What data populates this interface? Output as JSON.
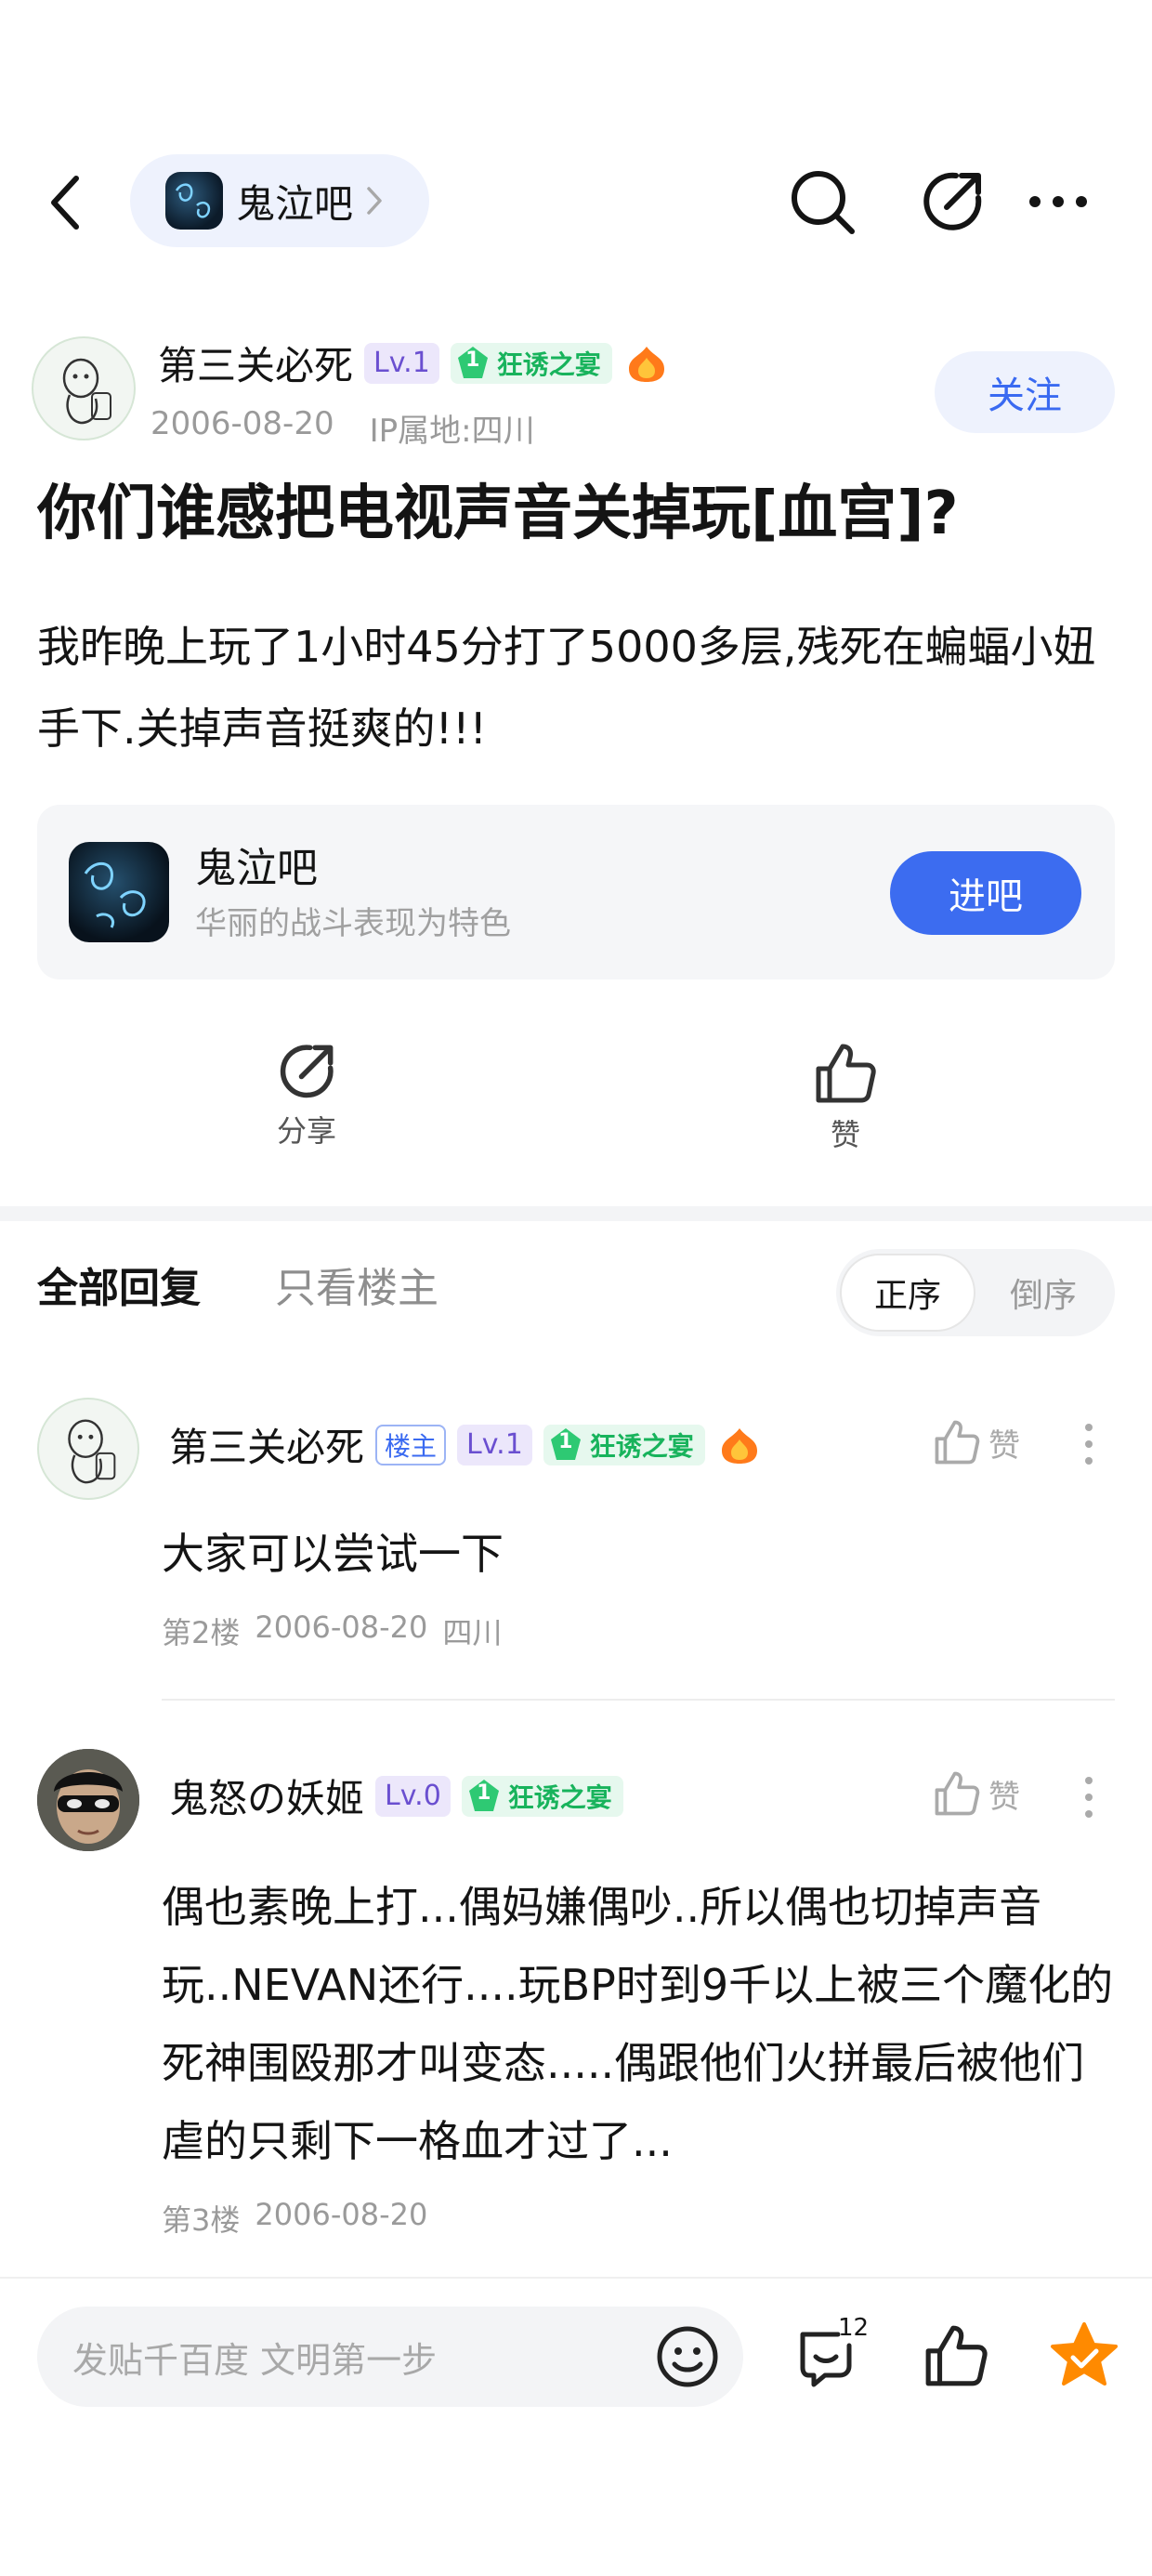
{
  "nav": {
    "forum_name": "鬼泣吧"
  },
  "post": {
    "author": "第三关必死",
    "level": "Lv.1",
    "honor_rank": "1",
    "honor_title": "狂诱之宴",
    "date": "2006-08-20",
    "ip": "IP属地:四川",
    "follow_label": "关注",
    "title": "你们谁感把电视声音关掉玩[血宫]?",
    "body": "我昨晚上玩了1小时45分打了5000多层,残死在蝙蝠小妞手下.关掉声音挺爽的!!!",
    "forum_card": {
      "name": "鬼泣吧",
      "desc": "华丽的战斗表现为特色",
      "enter_label": "进吧"
    },
    "actions": {
      "share_label": "分享",
      "like_label": "赞"
    }
  },
  "tabs": {
    "all_replies": "全部回复",
    "op_only": "只看楼主",
    "order_asc": "正序",
    "order_desc": "倒序"
  },
  "replies": [
    {
      "author": "第三关必死",
      "op_tag": "楼主",
      "level": "Lv.1",
      "honor_rank": "1",
      "honor_title": "狂诱之宴",
      "like_label": "赞",
      "text": "大家可以尝试一下",
      "floor": "第2楼",
      "date": "2006-08-20",
      "location": "四川"
    },
    {
      "author": "鬼怒の妖姬",
      "level": "Lv.0",
      "honor_rank": "1",
      "honor_title": "狂诱之宴",
      "like_label": "赞",
      "text": "偶也素晚上打...偶妈嫌偶吵..所以偶也切掉声音玩..NEVAN还行....玩BP时到9千以上被三个魔化的死神围殴那才叫变态.....偶跟他们火拼最后被他们虐的只剩下一格血才过了...",
      "floor": "第3楼",
      "date": "2006-08-20"
    }
  ],
  "bottom_bar": {
    "input_placeholder": "发贴千百度 文明第一步",
    "comment_count": "12"
  },
  "colors": {
    "accent": "#3c6cf0",
    "honor_green": "#18b35c",
    "level_purple": "#6a4fd0",
    "star_orange": "#ff8a00"
  }
}
